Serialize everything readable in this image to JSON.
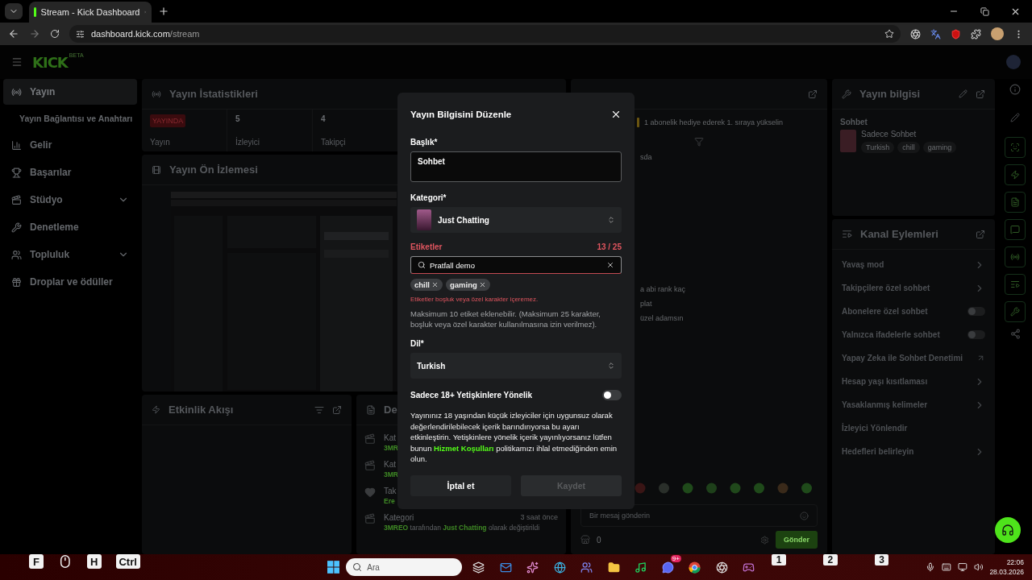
{
  "browser": {
    "tab_title": "Stream - Kick Dashboard",
    "url_host": "dashboard.kick.com",
    "url_path": "/stream"
  },
  "app": {
    "logo": "KICK",
    "logo_badge": "BETA"
  },
  "sidebar": {
    "items": [
      {
        "label": "Yayın",
        "kind": "main",
        "selected": true,
        "expandable": false
      },
      {
        "label": "Yayın Bağlantısı ve Anahtarı",
        "kind": "sub",
        "selected": false
      },
      {
        "label": "Gelir",
        "kind": "main",
        "selected": false,
        "expandable": false
      },
      {
        "label": "Başarılar",
        "kind": "main",
        "selected": false,
        "expandable": false
      },
      {
        "label": "Stüdyo",
        "kind": "main",
        "selected": false,
        "expandable": true
      },
      {
        "label": "Denetleme",
        "kind": "main",
        "selected": false,
        "expandable": false
      },
      {
        "label": "Topluluk",
        "kind": "main",
        "selected": false,
        "expandable": true
      },
      {
        "label": "Droplar ve ödüller",
        "kind": "main",
        "selected": false,
        "expandable": false
      }
    ]
  },
  "stats": {
    "title": "Yayın İstatistikleri",
    "cells": [
      {
        "value": "YAYINDA",
        "label": "Yayın",
        "kind": "badge"
      },
      {
        "value": "5",
        "label": "İzleyici",
        "kind": "number"
      },
      {
        "value": "4",
        "label": "Takipçi",
        "kind": "number"
      }
    ]
  },
  "preview": {
    "title": "Yayın Ön İzlemesi"
  },
  "activity": {
    "title": "Etkinlik Akışı"
  },
  "log": {
    "title": "De",
    "items": [
      {
        "title": "Kat",
        "detail": "**3MR**",
        "kind": "category"
      },
      {
        "title": "Kat",
        "detail": "**3MR**",
        "kind": "category"
      },
      {
        "title": "Tak",
        "detail": "**Ere**",
        "kind": "follow"
      },
      {
        "title": "Kategori",
        "detail": "**3MREO** tarafından **Just Chatting** olarak değiştirildi",
        "time": "3 saat önce",
        "kind": "category"
      }
    ]
  },
  "chat": {
    "pinned": "1 abonelik hediye ederek 1. sıraya yükselin",
    "messages": [
      "sda",
      "a abi rank kaç",
      "plat",
      "üzel adamsın"
    ],
    "input_placeholder": "Bir mesaj gönderin",
    "points": "0",
    "send": "Gönder"
  },
  "stream_info": {
    "title": "Yayın bilgisi",
    "stream_title": "Sohbet",
    "category": "Sadece Sohbet",
    "tags": [
      "Turkish",
      "chill",
      "gaming"
    ]
  },
  "channel_actions": {
    "title": "Kanal Eylemleri",
    "items": [
      {
        "label": "Yavaş mod",
        "kind": "link"
      },
      {
        "label": "Takipçilere özel sohbet",
        "kind": "link"
      },
      {
        "label": "Abonelere özel sohbet",
        "kind": "toggle",
        "on": false
      },
      {
        "label": "Yalnızca ifadelerle sohbet",
        "kind": "toggle",
        "on": false
      },
      {
        "label": "Yapay Zeka ile Sohbet Denetimi",
        "kind": "external"
      },
      {
        "label": "Hesap yaşı kısıtlaması",
        "kind": "link"
      },
      {
        "label": "Yasaklanmış kelimeler",
        "kind": "link"
      },
      {
        "label": "İzleyici Yönlendir",
        "kind": "plain"
      },
      {
        "label": "Hedefleri belirleyin",
        "kind": "link"
      }
    ]
  },
  "modal": {
    "title": "Yayın Bilgisini Düzenle",
    "title_label": "Başlık*",
    "title_value": "Sohbet",
    "category_label": "Kategori*",
    "category_value": "Just Chatting",
    "tags_label": "Etiketler",
    "tags_invalid": true,
    "tags_count": "13 / 25",
    "tags_input": "Pratfall demo",
    "tags": [
      "chill",
      "gaming"
    ],
    "tags_error": "Etiketler boşluk veya özel karakter içeremez.",
    "tags_help": "Maksimum 10 etiket eklenebilir. (Maksimum 25 karakter, boşluk veya özel karakter kullanılmasına izin verilmez).",
    "language_label": "Dil*",
    "language_value": "Turkish",
    "adult": {
      "label": "Sadece 18+ Yetişkinlere Yönelik",
      "on": false
    },
    "notice_before": "Yayınınız 18 yaşından küçük izleyiciler için uygunsuz olarak değerlendirilebilecek içerik barındırıyorsa bu ayarı etkinleştirin. Yetişkinlere yönelik içerik yayınlıyorsanız lütfen bunun",
    "notice_link": "Hizmet Koşulları",
    "notice_after": "politikamızı ihlal etmediğinden emin olun.",
    "cancel": "İptal et",
    "save": {
      "label": "Kaydet",
      "disabled": true
    }
  },
  "taskbar": {
    "keys": [
      {
        "label": "F",
        "kind": "key"
      },
      {
        "kind": "mouse"
      },
      {
        "label": "H",
        "kind": "key"
      },
      {
        "label": "Ctrl",
        "kind": "key"
      }
    ],
    "search": "Ara",
    "badge": "9+",
    "numbers": [
      "1",
      "2",
      "3"
    ],
    "time": "22:06",
    "date": "28.03.2026"
  }
}
